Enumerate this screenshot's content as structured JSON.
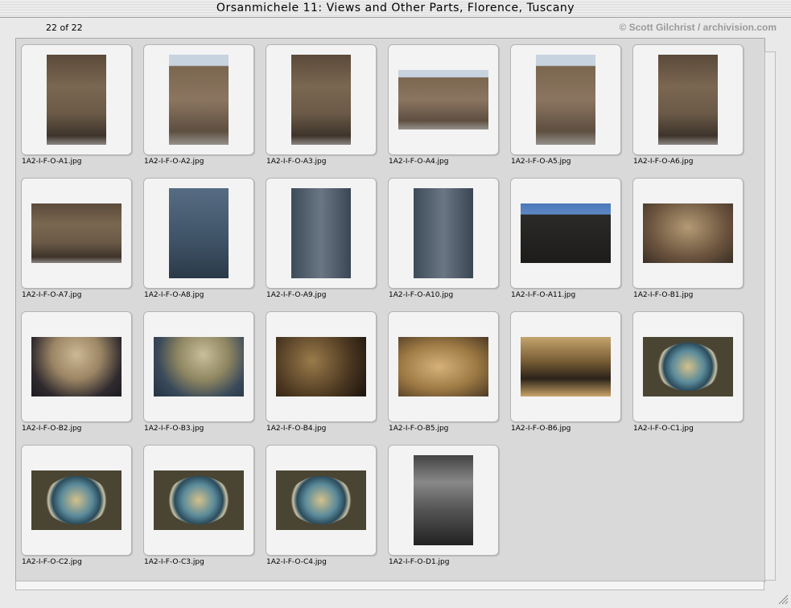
{
  "window": {
    "title": "Orsanmichele 11: Views and Other Parts, Florence, Tuscany"
  },
  "header": {
    "count": "22 of 22",
    "credit": "© Scott Gilchrist / archivision.com"
  },
  "slides": [
    {
      "file": "1A2-I-F-O-A1.jpg",
      "icon": "photo-icon",
      "look": "bld"
    },
    {
      "file": "1A2-I-F-O-A2.jpg",
      "icon": "photo-icon",
      "look": "bldsky"
    },
    {
      "file": "1A2-I-F-O-A3.jpg",
      "icon": "photo-icon",
      "look": "bld"
    },
    {
      "file": "1A2-I-F-O-A4.jpg",
      "icon": "photo-icon",
      "look": "bldsky"
    },
    {
      "file": "1A2-I-F-O-A5.jpg",
      "icon": "photo-icon",
      "look": "bldsky"
    },
    {
      "file": "1A2-I-F-O-A6.jpg",
      "icon": "photo-icon",
      "look": "bld"
    },
    {
      "file": "1A2-I-F-O-A7.jpg",
      "icon": "photo-icon",
      "look": "bld"
    },
    {
      "file": "1A2-I-F-O-A8.jpg",
      "icon": "photo-icon",
      "look": "bluetint"
    },
    {
      "file": "1A2-I-F-O-A9.jpg",
      "icon": "photo-icon",
      "look": "blue"
    },
    {
      "file": "1A2-I-F-O-A10.jpg",
      "icon": "photo-icon",
      "look": "blue"
    },
    {
      "file": "1A2-I-F-O-A11.jpg",
      "icon": "photo-icon",
      "look": "skyroof"
    },
    {
      "file": "1A2-I-F-O-B1.jpg",
      "icon": "photo-icon",
      "look": "door"
    },
    {
      "file": "1A2-I-F-O-B2.jpg",
      "icon": "photo-icon",
      "look": "tracery"
    },
    {
      "file": "1A2-I-F-O-B3.jpg",
      "icon": "photo-icon",
      "look": "traceryb"
    },
    {
      "file": "1A2-I-F-O-B4.jpg",
      "icon": "photo-icon",
      "look": "dark"
    },
    {
      "file": "1A2-I-F-O-B5.jpg",
      "icon": "photo-icon",
      "look": "relief"
    },
    {
      "file": "1A2-I-F-O-B6.jpg",
      "icon": "photo-icon",
      "look": "arch"
    },
    {
      "file": "1A2-I-F-O-C1.jpg",
      "icon": "photo-icon",
      "look": "roundel"
    },
    {
      "file": "1A2-I-F-O-C2.jpg",
      "icon": "photo-icon",
      "look": "roundel"
    },
    {
      "file": "1A2-I-F-O-C3.jpg",
      "icon": "photo-icon",
      "look": "roundel"
    },
    {
      "file": "1A2-I-F-O-C4.jpg",
      "icon": "photo-icon",
      "look": "roundel"
    },
    {
      "file": "1A2-I-F-O-D1.jpg",
      "icon": "photo-icon",
      "look": "bw"
    }
  ]
}
